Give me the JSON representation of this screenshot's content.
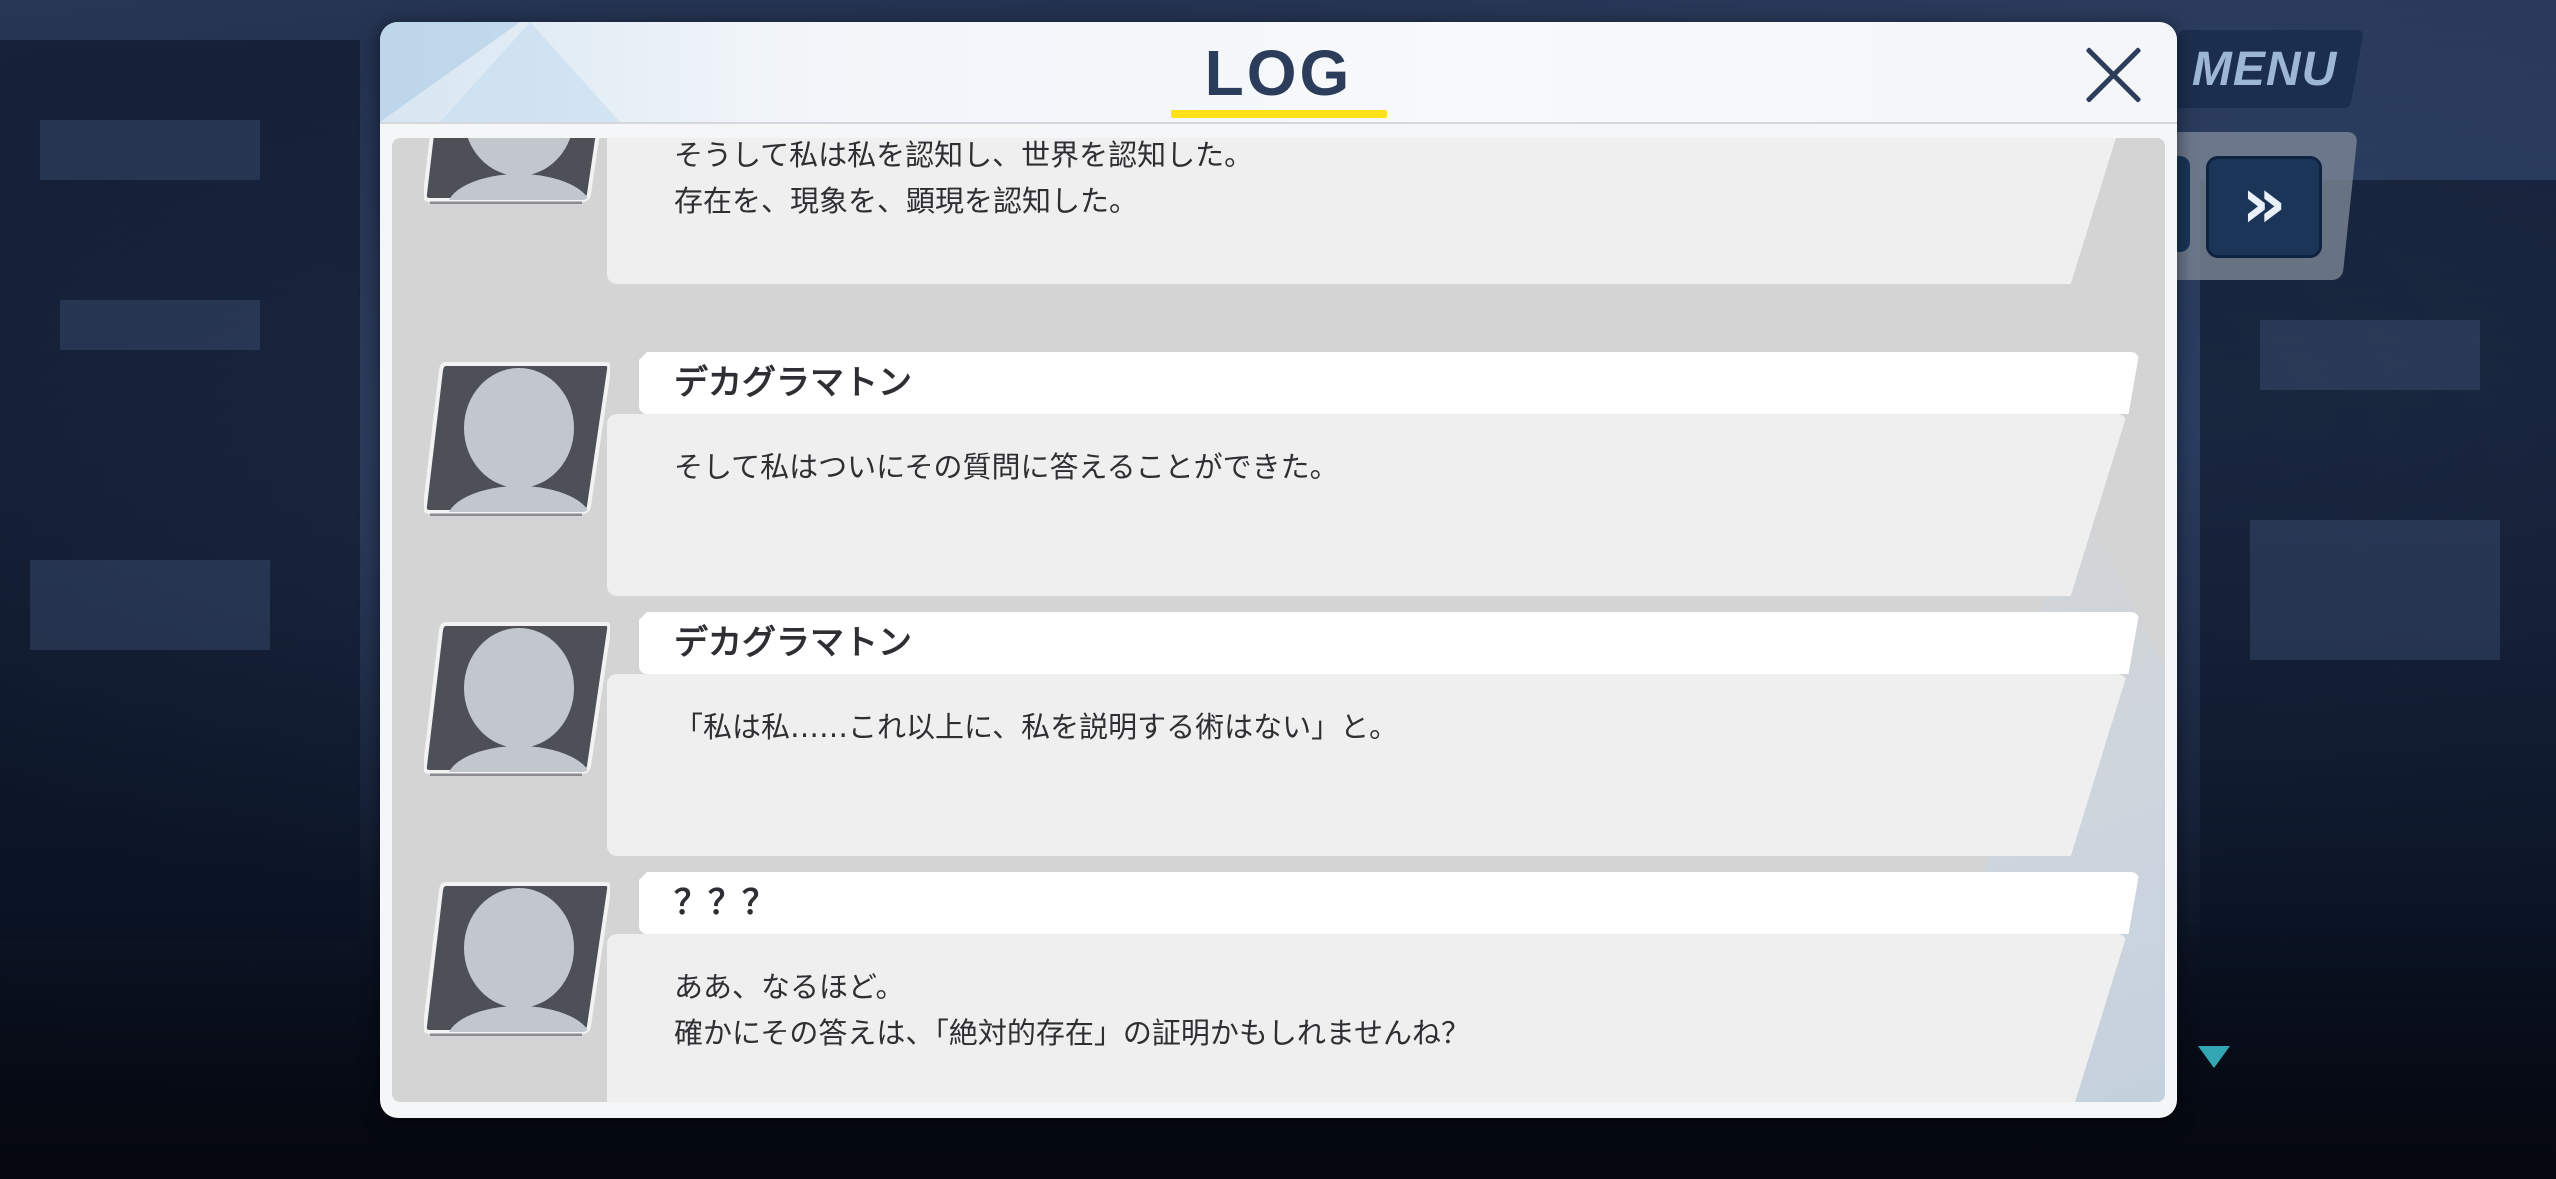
{
  "header": {
    "title": "LOG",
    "close_icon": "close-icon"
  },
  "controls": {
    "menu_label": "MENU",
    "fast_forward_icon": "fast-forward-icon",
    "fast_forward_glyph": "»",
    "scroll_down_icon": "down-triangle-icon"
  },
  "colors": {
    "title_underline": "#ffe11a",
    "title_text": "#2b3d5a",
    "menu_bg": "#1c2e4e",
    "marker": "#32a7b3"
  },
  "entries": [
    {
      "name": "",
      "avatar_icon": "avatar-placeholder-icon",
      "text": "そうして私は私を認知し、世界を認知した。\n存在を、現象を、顕現を認知した。"
    },
    {
      "name": "デカグラマトン",
      "avatar_icon": "avatar-placeholder-icon",
      "text": "そして私はついにその質問に答えることができた。"
    },
    {
      "name": "デカグラマトン",
      "avatar_icon": "avatar-placeholder-icon",
      "text": "「私は私……これ以上に、私を説明する術はない」と。"
    },
    {
      "name": "？？？",
      "avatar_icon": "avatar-placeholder-icon",
      "text": "ああ、なるほど。\n確かにその答えは、「絶対的存在」の証明かもしれませんね？"
    }
  ]
}
